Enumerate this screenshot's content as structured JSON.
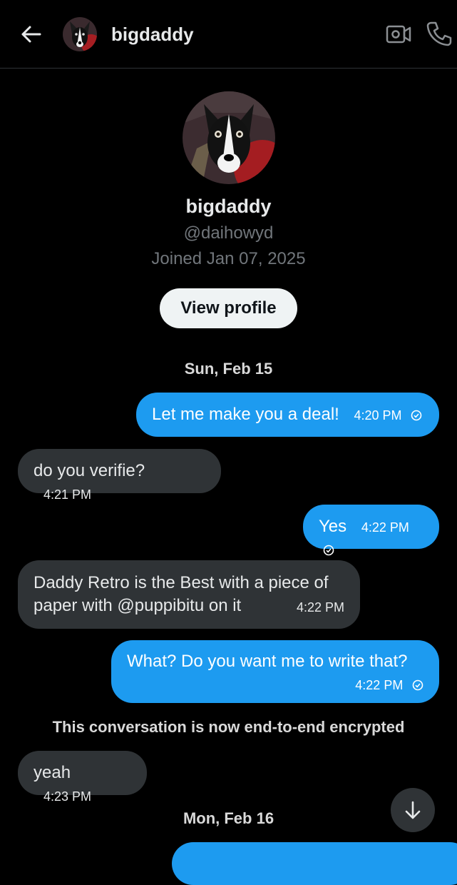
{
  "header": {
    "contact_name": "bigdaddy",
    "back_icon": "arrow-left-icon",
    "video_icon": "video-call-icon",
    "call_icon": "phone-call-icon"
  },
  "profile": {
    "name": "bigdaddy",
    "handle": "@daihowyd",
    "joined": "Joined Jan 07, 2025",
    "view_profile_label": "View profile"
  },
  "dates": {
    "first": "Sun, Feb 15",
    "second": "Mon, Feb 16"
  },
  "messages": [
    {
      "direction": "out",
      "text": "Let me make you a deal!",
      "time": "4:20 PM",
      "seen": true
    },
    {
      "direction": "in",
      "text": "do you verifie?",
      "time": "4:21 PM"
    },
    {
      "direction": "out",
      "text": "Yes",
      "time": "4:22 PM",
      "seen": true
    },
    {
      "direction": "in",
      "text_line1": "Daddy Retro is the Best with a piece of",
      "text_line2": "paper  with @puppibitu on it",
      "time": "4:22 PM"
    },
    {
      "direction": "out",
      "text": "What? Do you want me to write that?",
      "time": "4:22 PM",
      "seen": true
    },
    {
      "direction": "in",
      "text": "yeah",
      "time": "4:23 PM"
    }
  ],
  "encrypted_notice": "This conversation is now end-to-end encrypted",
  "scroll_down_icon": "arrow-down-icon",
  "colors": {
    "background": "#000000",
    "outgoing_bubble": "#1d9bf0",
    "incoming_bubble": "#2f3336",
    "secondary_text": "#71767b"
  }
}
